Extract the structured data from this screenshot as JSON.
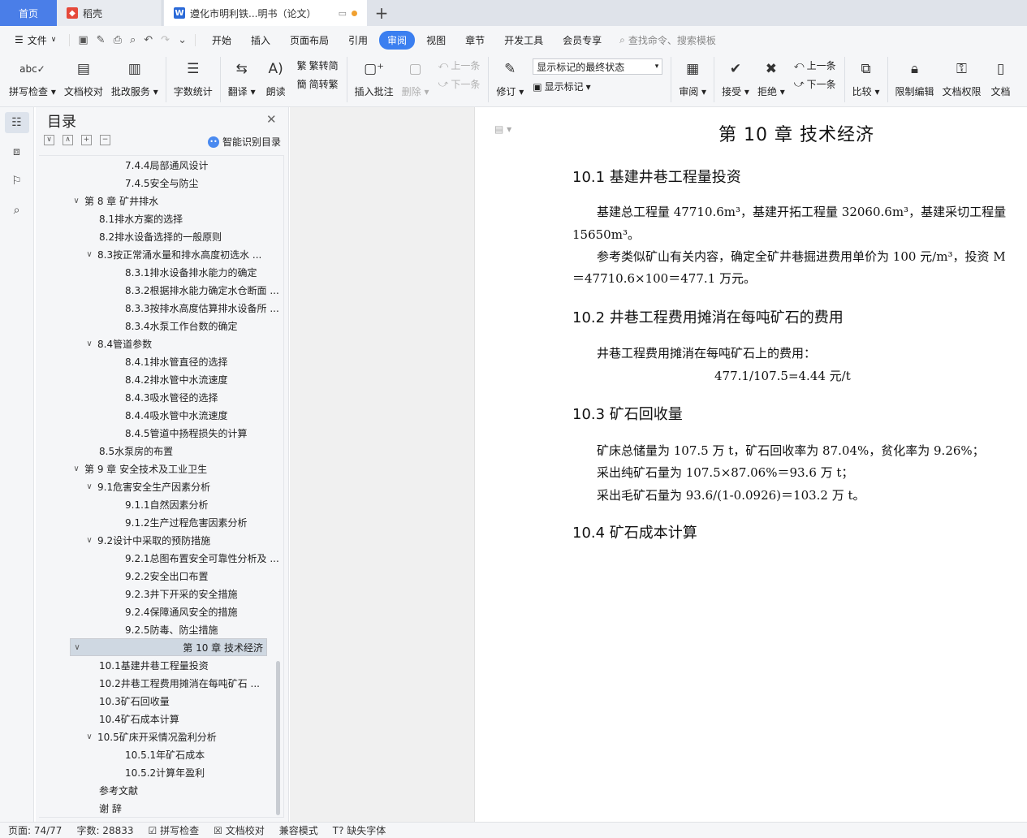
{
  "tabs": {
    "home": "首页",
    "straw": "稻壳",
    "doc": "遵化市明利铁...明书（论文）",
    "new_tab": "+"
  },
  "menu": {
    "file": "文件",
    "items": [
      "开始",
      "插入",
      "页面布局",
      "引用",
      "审阅",
      "视图",
      "章节",
      "开发工具",
      "会员专享"
    ],
    "active": "审阅",
    "search_placeholder": "查找命令、搜索模板"
  },
  "ribbon": {
    "spell_check": "拼写检查",
    "doc_proof": "文档校对",
    "approval": "批改服务",
    "word_count": "字数统计",
    "translate": "翻译",
    "read_aloud": "朗读",
    "trad_simp": "繁转简",
    "simp_trad": "简转繁",
    "insert_comment": "插入批注",
    "delete": "删除",
    "prev": "上一条",
    "next": "下一条",
    "track_changes": "修订",
    "markup_state": "显示标记的最终状态",
    "show_markup": "显示标记",
    "review": "审阅",
    "accept": "接受",
    "reject": "拒绝",
    "prev2": "上一条",
    "next2": "下一条",
    "compare": "比较",
    "restrict_edit": "限制编辑",
    "doc_permission": "文档权限",
    "doc_cut": "文档"
  },
  "toc": {
    "title": "目录",
    "ai_label": "智能识别目录",
    "items": [
      {
        "level": 3,
        "text": "7.4.4局部通风设计",
        "chev": ""
      },
      {
        "level": 3,
        "text": "7.4.5安全与防尘",
        "chev": ""
      },
      {
        "level": 1,
        "text": "第 8 章 矿井排水",
        "chev": "v"
      },
      {
        "level": 2,
        "text": "8.1排水方案的选择",
        "chev": ""
      },
      {
        "level": 2,
        "text": "8.2排水设备选择的一般原则",
        "chev": ""
      },
      {
        "level": 2,
        "text": "8.3按正常涌水量和排水高度初选水 ...",
        "chev": "v"
      },
      {
        "level": 3,
        "text": "8.3.1排水设备排水能力的确定",
        "chev": ""
      },
      {
        "level": 3,
        "text": "8.3.2根据排水能力确定水仓断面 ...",
        "chev": ""
      },
      {
        "level": 3,
        "text": "8.3.3按排水高度估算排水设备所 ...",
        "chev": ""
      },
      {
        "level": 3,
        "text": "8.3.4水泵工作台数的确定",
        "chev": ""
      },
      {
        "level": 2,
        "text": "8.4管道参数",
        "chev": "v"
      },
      {
        "level": 3,
        "text": "8.4.1排水管直径的选择",
        "chev": ""
      },
      {
        "level": 3,
        "text": "8.4.2排水管中水流速度",
        "chev": ""
      },
      {
        "level": 3,
        "text": "8.4.3吸水管径的选择",
        "chev": ""
      },
      {
        "level": 3,
        "text": "8.4.4吸水管中水流速度",
        "chev": ""
      },
      {
        "level": 3,
        "text": "8.4.5管道中扬程损失的计算",
        "chev": ""
      },
      {
        "level": 2,
        "text": "8.5水泵房的布置",
        "chev": ""
      },
      {
        "level": 1,
        "text": "第 9 章 安全技术及工业卫生",
        "chev": "v"
      },
      {
        "level": 2,
        "text": "9.1危害安全生产因素分析",
        "chev": "v"
      },
      {
        "level": 3,
        "text": "9.1.1自然因素分析",
        "chev": ""
      },
      {
        "level": 3,
        "text": "9.1.2生产过程危害因素分析",
        "chev": ""
      },
      {
        "level": 2,
        "text": "9.2设计中采取的预防措施",
        "chev": "v"
      },
      {
        "level": 3,
        "text": "9.2.1总图布置安全可靠性分析及 ...",
        "chev": ""
      },
      {
        "level": 3,
        "text": "9.2.2安全出口布置",
        "chev": ""
      },
      {
        "level": 3,
        "text": "9.2.3井下开采的安全措施",
        "chev": ""
      },
      {
        "level": 3,
        "text": "9.2.4保障通风安全的措施",
        "chev": ""
      },
      {
        "level": 3,
        "text": "9.2.5防毒、防尘措施",
        "chev": ""
      },
      {
        "level": 1,
        "text": "第 10 章 技术经济",
        "chev": "v",
        "selected": true
      },
      {
        "level": 2,
        "text": "10.1基建井巷工程量投资",
        "chev": ""
      },
      {
        "level": 2,
        "text": "10.2井巷工程费用摊消在每吨矿石 ...",
        "chev": ""
      },
      {
        "level": 2,
        "text": "10.3矿石回收量",
        "chev": ""
      },
      {
        "level": 2,
        "text": "10.4矿石成本计算",
        "chev": ""
      },
      {
        "level": 2,
        "text": "10.5矿床开采情况盈利分析",
        "chev": "v"
      },
      {
        "level": 3,
        "text": "10.5.1年矿石成本",
        "chev": ""
      },
      {
        "level": 3,
        "text": "10.5.2计算年盈利",
        "chev": ""
      },
      {
        "level": 0,
        "text": "参考文献",
        "chev": ""
      },
      {
        "level": 0,
        "text": "谢  辞",
        "chev": ""
      }
    ]
  },
  "document": {
    "chapter": "第  10 章  技术经济",
    "s1": "10.1  基建井巷工程量投资",
    "p1a": "基建总工程量  47710.6m³，基建开拓工程量  32060.6m³，基建采切工程量",
    "p1b": "15650m³。",
    "p2a": "参考类似矿山有关内容，确定全矿井巷掘进费用单价为  100 元/m³，投资  M",
    "p2b": "＝47710.6×100＝477.1 万元。",
    "s2": "10.2  井巷工程费用摊消在每吨矿石的费用",
    "p3": "井巷工程费用摊消在每吨矿石上的费用：",
    "p4": "477.1/107.5=4.44 元/t",
    "s3": "10.3  矿石回收量",
    "p5": "矿床总储量为  107.5 万 t，矿石回收率为  87.04%，贫化率为  9.26%；",
    "p6": "采出纯矿石量为  107.5×87.06%＝93.6 万 t；",
    "p7": "采出毛矿石量为  93.6/(1-0.0926)＝103.2 万  t。",
    "s4": "10.4  矿石成本计算"
  },
  "status": {
    "page": "页面: 74/77",
    "words": "字数: 28833",
    "spell": "拼写检查",
    "proof": "文档校对",
    "compat": "兼容模式",
    "missing_font": "缺失字体"
  }
}
